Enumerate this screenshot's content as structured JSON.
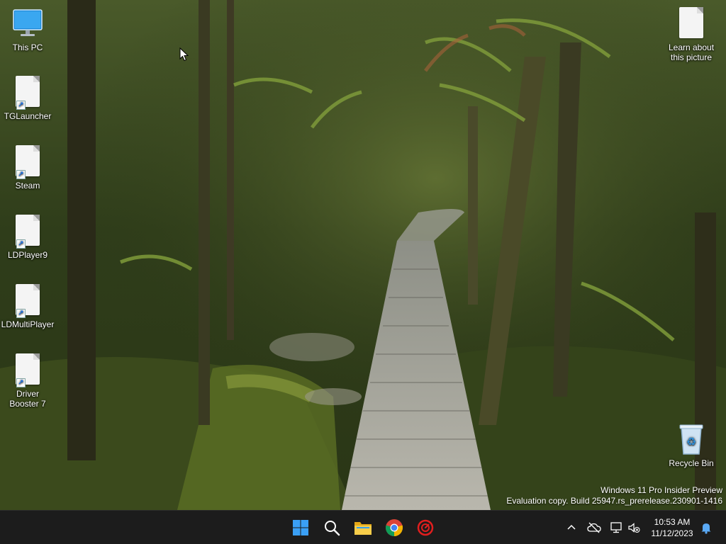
{
  "desktop": {
    "icons": [
      {
        "label": "This PC",
        "icon": "monitor-icon"
      },
      {
        "label": "TGLauncher",
        "icon": "file-shortcut-icon"
      },
      {
        "label": "Steam",
        "icon": "file-shortcut-icon"
      },
      {
        "label": "LDPlayer9",
        "icon": "file-shortcut-icon"
      },
      {
        "label": "LDMultiPlayer",
        "icon": "file-shortcut-icon"
      },
      {
        "label": "Driver Booster 7",
        "icon": "file-shortcut-icon"
      },
      {
        "label": "Learn about this picture",
        "icon": "file-icon"
      },
      {
        "label": "Recycle Bin",
        "icon": "recycle-bin-icon"
      }
    ]
  },
  "watermark": {
    "line1": "Windows 11 Pro Insider Preview",
    "line2": "Evaluation copy. Build 25947.rs_prerelease.230901-1416"
  },
  "taskbar": {
    "pinned": [
      {
        "name": "start",
        "icon": "windows-start-icon",
        "color": "#3a9ff5"
      },
      {
        "name": "search",
        "icon": "search-icon",
        "color": "#ffffff"
      },
      {
        "name": "file-explorer",
        "icon": "folder-icon",
        "color": "#f3c13a"
      },
      {
        "name": "chrome",
        "icon": "chrome-icon",
        "color": "#db4437"
      },
      {
        "name": "driver-booster",
        "icon": "driver-booster-icon",
        "color": "#e01e1e"
      }
    ],
    "tray": {
      "icons": [
        "chevron-up-icon",
        "cloud-offline-icon",
        "network-icon",
        "volume-muted-icon"
      ],
      "time": "10:53 AM",
      "date": "11/12/2023",
      "notification_icon": "bell-icon"
    }
  }
}
